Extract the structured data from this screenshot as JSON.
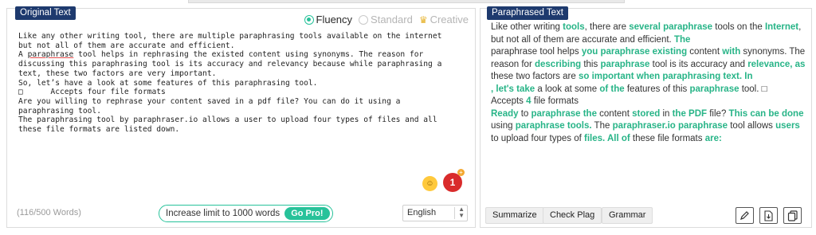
{
  "left_panel": {
    "tag": "Original Text",
    "modes": [
      {
        "label": "Fluency",
        "active": true
      },
      {
        "label": "Standard",
        "active": false
      },
      {
        "label": "Creative",
        "active": false,
        "icon": "crown-icon"
      }
    ],
    "text_lines": [
      "Like any other writing tool, there are multiple paraphrasing tools available on the internet",
      "but not all of them are accurate and efficient.",
      "A ",
      "paraphrase",
      " tool helps in rephrasing the existed content using synonyms. The reason for",
      "discussing this paraphrasing tool is its accuracy and relevancy because while paraphrasing a",
      "text, these two factors are very important.",
      "So, let’s have a look at some features of this paraphrasing tool.",
      "□      Accepts four file formats",
      "Are you willing to rephrase your content saved in a pdf file? You can do it using a",
      "paraphrasing tool.",
      "The paraphrasing tool by paraphraser.io allows a user to upload four types of files and all",
      "these file formats are listed down."
    ],
    "notification_count": "1",
    "notification_plus": "+",
    "word_count": "(116/500 Words)",
    "limit_text": "Increase limit to 1000 words",
    "go_pro": "Go Pro!",
    "language": "English",
    "accent_color": "#27c29a",
    "tag_color": "#1e3a6e"
  },
  "right_panel": {
    "tag": "Paraphrased Text",
    "segments": [
      {
        "t": "Like  other writing ",
        "h": false
      },
      {
        "t": "tools",
        "h": true
      },
      {
        "t": ", there are ",
        "h": false
      },
      {
        "t": "several paraphrase",
        "h": true
      },
      {
        "t": " tools  on the ",
        "h": false
      },
      {
        "t": "Internet",
        "h": true
      },
      {
        "t": ", but not all of them are accurate and efficient. ",
        "h": false
      },
      {
        "t": "The",
        "h": true
      },
      {
        "t": "\n  paraphrase tool helps ",
        "h": false
      },
      {
        "t": "you paraphrase existing",
        "h": true
      },
      {
        "t": " content ",
        "h": false
      },
      {
        "t": "with",
        "h": true
      },
      {
        "t": " synonyms. The reason for ",
        "h": false
      },
      {
        "t": "describing",
        "h": true
      },
      {
        "t": " this ",
        "h": false
      },
      {
        "t": "paraphrase",
        "h": true
      },
      {
        "t": " tool is its accuracy and ",
        "h": false
      },
      {
        "t": "relevance, as",
        "h": true
      },
      {
        "t": " these two factors are ",
        "h": false
      },
      {
        "t": "so important when paraphrasing text. In",
        "h": true
      },
      {
        "t": "\n",
        "h": false
      },
      {
        "t": ", let's take",
        "h": true
      },
      {
        "t": " a look at some ",
        "h": false
      },
      {
        "t": "of the",
        "h": true
      },
      {
        "t": " features of this ",
        "h": false
      },
      {
        "t": "paraphrase",
        "h": true
      },
      {
        "t": " tool.  □\nAccepts ",
        "h": false
      },
      {
        "t": "4",
        "h": true
      },
      {
        "t": " file formats\n ",
        "h": false
      },
      {
        "t": "Ready",
        "h": true
      },
      {
        "t": " to ",
        "h": false
      },
      {
        "t": "paraphrase the",
        "h": true
      },
      {
        "t": " content ",
        "h": false
      },
      {
        "t": "stored",
        "h": true
      },
      {
        "t": " in ",
        "h": false
      },
      {
        "t": "the PDF",
        "h": true
      },
      {
        "t": " file? ",
        "h": false
      },
      {
        "t": "This can be done",
        "h": true
      },
      {
        "t": " using ",
        "h": false
      },
      {
        "t": "paraphrase tools.",
        "h": true
      },
      {
        "t": " The ",
        "h": false
      },
      {
        "t": "paraphraser.io paraphrase",
        "h": true
      },
      {
        "t": " tool allows ",
        "h": false
      },
      {
        "t": "users",
        "h": true
      },
      {
        "t": " to upload four types of ",
        "h": false
      },
      {
        "t": "files. All of",
        "h": true
      },
      {
        "t": " these file formats ",
        "h": false
      },
      {
        "t": "are:",
        "h": true
      }
    ],
    "buttons": {
      "summarize": "Summarize",
      "check_plag": "Check Plag",
      "grammar": "Grammar"
    },
    "icons": [
      "pencil-icon",
      "download-icon",
      "copy-icon"
    ],
    "highlight_color": "#27b487"
  }
}
